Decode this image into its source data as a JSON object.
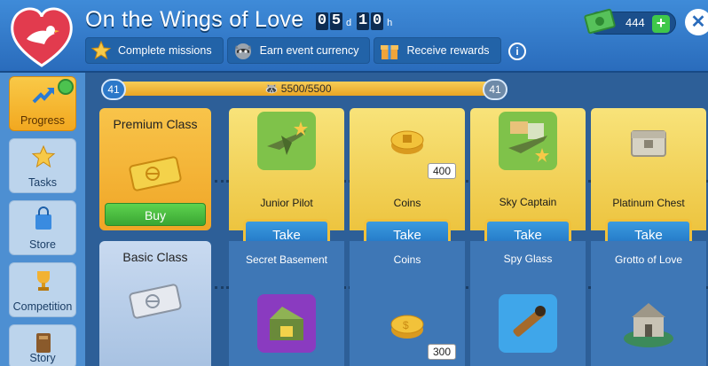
{
  "header": {
    "title": "On the Wings of Love",
    "timer": {
      "d1": "0",
      "d2": "5",
      "d_unit": "d",
      "h1": "1",
      "h2": "0",
      "h_unit": "h"
    },
    "chips": [
      {
        "label": "Complete missions",
        "icon": "star-icon"
      },
      {
        "label": "Earn event currency",
        "icon": "raccoon-icon"
      },
      {
        "label": "Receive rewards",
        "icon": "gift-icon"
      }
    ],
    "info_label": "i",
    "currency_amount": "444",
    "plus_label": "+",
    "close_label": "✕"
  },
  "sidebar": {
    "items": [
      {
        "label": "Progress",
        "icon": "chart-up-icon",
        "active": true
      },
      {
        "label": "Tasks",
        "icon": "star-icon"
      },
      {
        "label": "Store",
        "icon": "shopping-bag-icon"
      },
      {
        "label": "Competition",
        "icon": "trophy-icon"
      },
      {
        "label": "Story",
        "icon": "book-icon"
      }
    ]
  },
  "progress": {
    "level_left": "41",
    "level_right": "41",
    "text": "5500/5500",
    "fraction": 1.0
  },
  "classes": {
    "premium": {
      "name": "Premium Class",
      "buy_label": "Buy"
    },
    "basic": {
      "name": "Basic Class"
    }
  },
  "rewards": [
    {
      "premium_name": "Junior Pilot",
      "premium_count": "",
      "take_label": "Take",
      "basic_name": "Secret Basement",
      "basic_count": ""
    },
    {
      "premium_name": "Coins",
      "premium_count": "400",
      "take_label": "Take",
      "basic_name": "Coins",
      "basic_count": "300"
    },
    {
      "premium_name": "Sky Captain",
      "premium_count": "",
      "take_label": "Take",
      "basic_name": "Spy Glass",
      "basic_count": ""
    },
    {
      "premium_name": "Platinum Chest",
      "premium_count": "",
      "take_label": "Take",
      "basic_name": "Grotto of Love",
      "basic_count": ""
    }
  ],
  "colors": {
    "header_blue": "#2a6cbc",
    "premium_gold": "#f0a526",
    "take_blue": "#1d6fc0",
    "buy_green": "#3aa633"
  }
}
